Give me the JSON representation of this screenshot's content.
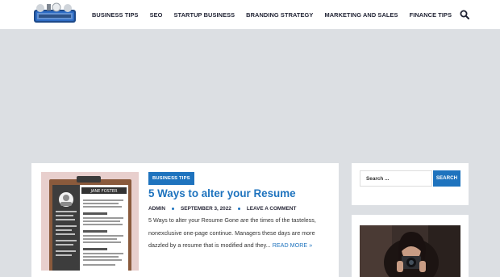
{
  "header": {
    "logo_alt": "Business logo",
    "nav": [
      {
        "label": "BUSINESS TIPS"
      },
      {
        "label": "SEO"
      },
      {
        "label": "STARTUP BUSINESS"
      },
      {
        "label": "BRANDING STRATEGY"
      },
      {
        "label": "MARKETING AND SALES"
      },
      {
        "label": "FINANCE TIPS"
      }
    ],
    "search_icon": "search-icon"
  },
  "post": {
    "category": "BUSINESS TIPS",
    "title": "5 Ways to alter your Resume",
    "author": "ADMIN",
    "date": "SEPTEMBER 3, 2022",
    "comment_link": "LEAVE A COMMENT",
    "excerpt": "5 Ways to alter your Resume Gone are the times of the tasteless, nonexclusive one-page continue. Managers these days are more dazzled by a resume that is modified and they...",
    "read_more": "READ MORE »",
    "thumbnail_name": "JANE FOSTER"
  },
  "sidebar": {
    "search_placeholder": "Search ...",
    "search_button": "SEARCH"
  },
  "colors": {
    "accent": "#1e73be",
    "background": "#dcdfe3",
    "text": "#1f2233"
  }
}
